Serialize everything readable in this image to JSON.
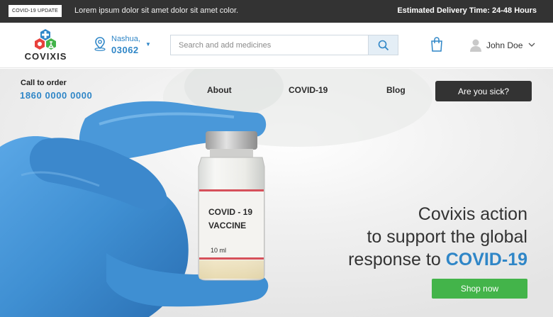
{
  "announcement": {
    "badge": "COVID-19 UPDATE",
    "message": "Lorem ipsum dolor sit amet dolor sit amet color.",
    "delivery": "Estimated Delivery Time: 24-48 Hours"
  },
  "header": {
    "logo_text": "COVIXIS",
    "location": {
      "city": "Nashua,",
      "zip": "03062"
    },
    "search": {
      "placeholder": "Search and add medicines",
      "value": ""
    },
    "user": {
      "name": "John Doe"
    }
  },
  "hero": {
    "call_label": "Call to order",
    "call_number": "1860 0000 0000",
    "nav": [
      "About",
      "COVID-19",
      "Blog"
    ],
    "cta_sick": "Are you sick?",
    "vial": {
      "line1": "COVID - 19",
      "line2": "VACCINE",
      "volume": "10 ml"
    },
    "headline": {
      "line1": "Covixis action",
      "line2": "to support the global",
      "line3_prefix": "response to ",
      "line3_emphasis": "COVID-19"
    },
    "shop_button": "Shop now"
  },
  "colors": {
    "accent_blue": "#2f86c7",
    "dark_bar": "#333333",
    "shop_green": "#43b44a",
    "glove_blue": "#3f8fd2"
  },
  "icons": [
    "medical-cross-logo-icon",
    "location-pin-icon",
    "search-icon",
    "shopping-bag-icon",
    "user-avatar-icon",
    "chevron-down-icon"
  ]
}
